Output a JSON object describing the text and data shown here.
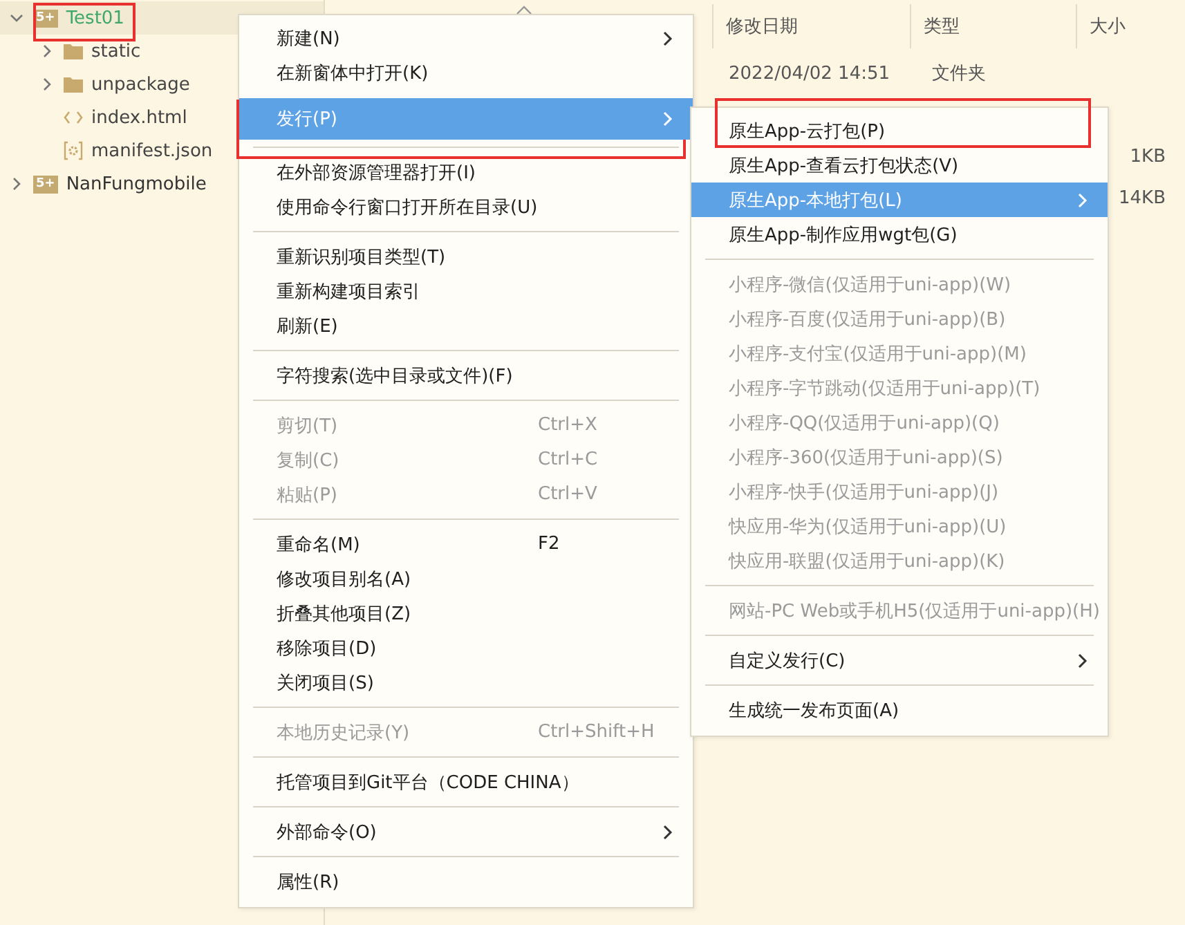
{
  "project_tree": [
    {
      "name": "Test01",
      "kind": "project",
      "icon_text": "5+",
      "expanded": true,
      "selected": true,
      "highlighted": true,
      "children": [
        {
          "name": "static",
          "kind": "folder",
          "expanded": false
        },
        {
          "name": "unpackage",
          "kind": "folder",
          "expanded": false
        },
        {
          "name": "index.html",
          "kind": "html"
        },
        {
          "name": "manifest.json",
          "kind": "json"
        }
      ]
    },
    {
      "name": "NanFungmobile",
      "kind": "project",
      "icon_text": "5+",
      "expanded": false,
      "selected": false
    }
  ],
  "file_list": {
    "columns": [
      "修改日期",
      "类型",
      "大小"
    ],
    "rows": [
      {
        "modified": "2022/04/02 14:51",
        "type": "文件夹"
      },
      {},
      {
        "size": "1KB"
      },
      {
        "size": "14KB"
      }
    ]
  },
  "context_menu": {
    "items": [
      {
        "kind": "item",
        "label": "新建(N)",
        "submenu": true,
        "disabled": false,
        "selected": false
      },
      {
        "kind": "item",
        "label": "在新窗体中打开(K)",
        "disabled": false,
        "selected": false
      },
      {
        "kind": "item",
        "label": "发行(P)",
        "submenu": true,
        "disabled": false,
        "selected": true,
        "highlighted": true
      },
      {
        "kind": "separator"
      },
      {
        "kind": "item",
        "label": "在外部资源管理器打开(I)",
        "disabled": false,
        "selected": false
      },
      {
        "kind": "item",
        "label": "使用命令行窗口打开所在目录(U)",
        "disabled": false,
        "selected": false
      },
      {
        "kind": "separator"
      },
      {
        "kind": "item",
        "label": "重新识别项目类型(T)",
        "disabled": false,
        "selected": false
      },
      {
        "kind": "item",
        "label": "重新构建项目索引",
        "disabled": false,
        "selected": false
      },
      {
        "kind": "item",
        "label": "刷新(E)",
        "disabled": false,
        "selected": false
      },
      {
        "kind": "separator"
      },
      {
        "kind": "item",
        "label": "字符搜索(选中目录或文件)(F)",
        "disabled": false,
        "selected": false
      },
      {
        "kind": "separator"
      },
      {
        "kind": "item",
        "label": "剪切(T)",
        "shortcut": "Ctrl+X",
        "disabled": true,
        "selected": false
      },
      {
        "kind": "item",
        "label": "复制(C)",
        "shortcut": "Ctrl+C",
        "disabled": true,
        "selected": false
      },
      {
        "kind": "item",
        "label": "粘贴(P)",
        "shortcut": "Ctrl+V",
        "disabled": true,
        "selected": false
      },
      {
        "kind": "separator"
      },
      {
        "kind": "item",
        "label": "重命名(M)",
        "shortcut": "F2",
        "disabled": false,
        "selected": false
      },
      {
        "kind": "item",
        "label": "修改项目别名(A)",
        "disabled": false,
        "selected": false
      },
      {
        "kind": "item",
        "label": "折叠其他项目(Z)",
        "disabled": false,
        "selected": false
      },
      {
        "kind": "item",
        "label": "移除项目(D)",
        "disabled": false,
        "selected": false
      },
      {
        "kind": "item",
        "label": "关闭项目(S)",
        "disabled": false,
        "selected": false
      },
      {
        "kind": "separator"
      },
      {
        "kind": "item",
        "label": "本地历史记录(Y)",
        "shortcut": "Ctrl+Shift+H",
        "disabled": true,
        "selected": false
      },
      {
        "kind": "separator"
      },
      {
        "kind": "item",
        "label": "托管项目到Git平台（CODE CHINA）",
        "disabled": false,
        "selected": false
      },
      {
        "kind": "separator"
      },
      {
        "kind": "item",
        "label": "外部命令(O)",
        "submenu": true,
        "disabled": false,
        "selected": false
      },
      {
        "kind": "separator"
      },
      {
        "kind": "item",
        "label": "属性(R)",
        "disabled": false,
        "selected": false
      }
    ]
  },
  "submenu": {
    "items": [
      {
        "kind": "item",
        "label": "原生App-云打包(P)",
        "disabled": false,
        "selected": false,
        "highlighted": true
      },
      {
        "kind": "item",
        "label": "原生App-查看云打包状态(V)",
        "disabled": false,
        "selected": false
      },
      {
        "kind": "item",
        "label": "原生App-本地打包(L)",
        "submenu": true,
        "disabled": false,
        "selected": true
      },
      {
        "kind": "item",
        "label": "原生App-制作应用wgt包(G)",
        "disabled": false,
        "selected": false
      },
      {
        "kind": "separator"
      },
      {
        "kind": "item",
        "label": "小程序-微信(仅适用于uni-app)(W)",
        "disabled": true,
        "selected": false
      },
      {
        "kind": "item",
        "label": "小程序-百度(仅适用于uni-app)(B)",
        "disabled": true,
        "selected": false
      },
      {
        "kind": "item",
        "label": "小程序-支付宝(仅适用于uni-app)(M)",
        "disabled": true,
        "selected": false
      },
      {
        "kind": "item",
        "label": "小程序-字节跳动(仅适用于uni-app)(T)",
        "disabled": true,
        "selected": false
      },
      {
        "kind": "item",
        "label": "小程序-QQ(仅适用于uni-app)(Q)",
        "disabled": true,
        "selected": false
      },
      {
        "kind": "item",
        "label": "小程序-360(仅适用于uni-app)(S)",
        "disabled": true,
        "selected": false
      },
      {
        "kind": "item",
        "label": "小程序-快手(仅适用于uni-app)(J)",
        "disabled": true,
        "selected": false
      },
      {
        "kind": "item",
        "label": "快应用-华为(仅适用于uni-app)(U)",
        "disabled": true,
        "selected": false
      },
      {
        "kind": "item",
        "label": "快应用-联盟(仅适用于uni-app)(K)",
        "disabled": true,
        "selected": false
      },
      {
        "kind": "separator"
      },
      {
        "kind": "item",
        "label": "网站-PC Web或手机H5(仅适用于uni-app)(H)",
        "disabled": true,
        "selected": false
      },
      {
        "kind": "separator"
      },
      {
        "kind": "item",
        "label": "自定义发行(C)",
        "submenu": true,
        "disabled": false,
        "selected": false
      },
      {
        "kind": "separator"
      },
      {
        "kind": "item",
        "label": "生成统一发布页面(A)",
        "disabled": false,
        "selected": false
      }
    ]
  }
}
